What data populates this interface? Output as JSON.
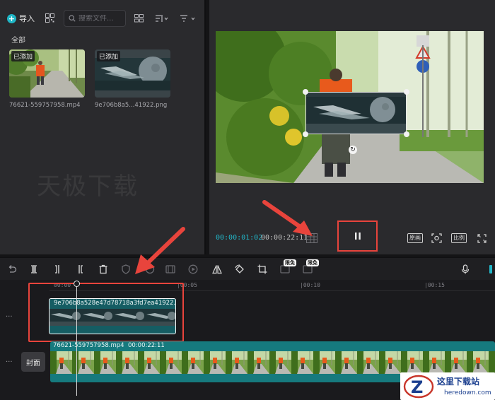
{
  "media_panel": {
    "import_label": "导入",
    "search_placeholder": "搜索文件...",
    "all_label": "全部",
    "watermark": "天极下载",
    "items": [
      {
        "badge": "已添加",
        "name": "76621-559757958.mp4"
      },
      {
        "badge": "已添加",
        "name": "9e706b8a5...41922.png"
      }
    ]
  },
  "player": {
    "current_time": "00:00:01:02",
    "total_time": "00:00:22:11",
    "original_label": "原画",
    "ratio_label": "比例"
  },
  "toolbar": {
    "free_badge_1": "限免",
    "free_badge_2": "限免"
  },
  "timeline": {
    "ruler_labels": [
      "00:00",
      "|00:05",
      "|00:10",
      "|00:15"
    ],
    "overlay_clip_name": "9e706b8a528e47d78718a3fd7ea41922.png",
    "main_clip_name": "76621-559757958.mp4",
    "main_clip_duration": "00:00:22:11",
    "cover_label": "封面",
    "track_menu": "..."
  },
  "logo": {
    "cn": "这里下载站",
    "en": "heredown.com"
  },
  "colors": {
    "accent": "#22b6c8",
    "annotation_red": "#e8443c",
    "clip_teal": "#167a7e"
  }
}
